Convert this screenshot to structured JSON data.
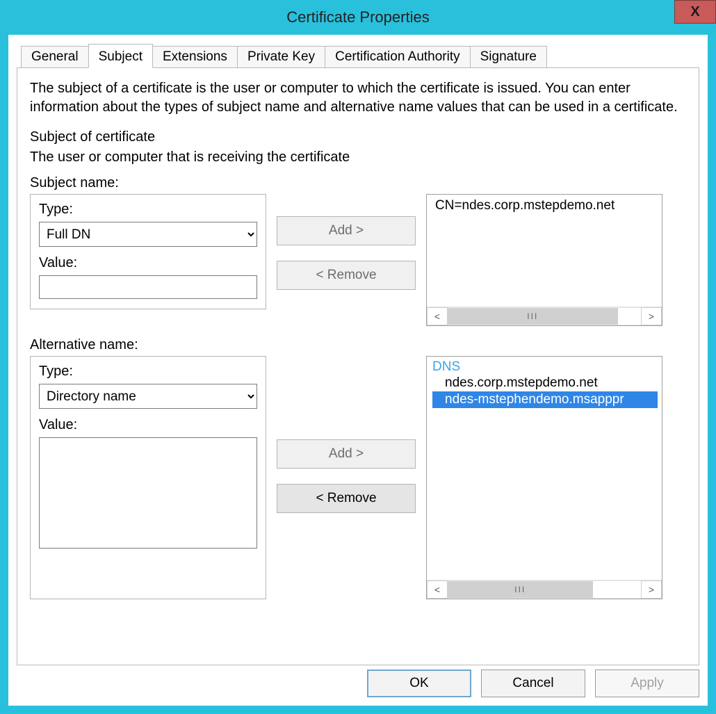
{
  "window": {
    "title": "Certificate Properties",
    "close_glyph": "✕"
  },
  "tabs": {
    "general": "General",
    "subject": "Subject",
    "extensions": "Extensions",
    "private_key": "Private Key",
    "ca": "Certification Authority",
    "signature": "Signature",
    "active": "subject"
  },
  "subject_tab": {
    "intro": "The subject of a certificate is the user or computer to which the certificate is issued. You can enter information about the types of subject name and alternative name values that can be used in a certificate.",
    "section_title": "Subject of certificate",
    "section_subtitle": "The user or computer that is receiving the certificate",
    "subject_name_label": "Subject name:",
    "alt_name_label": "Alternative name:",
    "type_label": "Type:",
    "value_label": "Value:",
    "add_label": "Add >",
    "remove_label": "< Remove",
    "subject_type_value": "Full DN",
    "subject_value_value": "",
    "alt_type_value": "Directory name",
    "alt_value_value": "",
    "subject_list": {
      "items": [
        "CN=ndes.corp.mstepdemo.net"
      ],
      "scroll_grip": "III"
    },
    "alt_list": {
      "category": "DNS",
      "items": [
        {
          "text": "ndes.corp.mstepdemo.net",
          "selected": false
        },
        {
          "text": "ndes-mstephendemo.msapppr",
          "selected": true
        }
      ],
      "scroll_grip": "III"
    }
  },
  "footer": {
    "ok": "OK",
    "cancel": "Cancel",
    "apply": "Apply"
  }
}
